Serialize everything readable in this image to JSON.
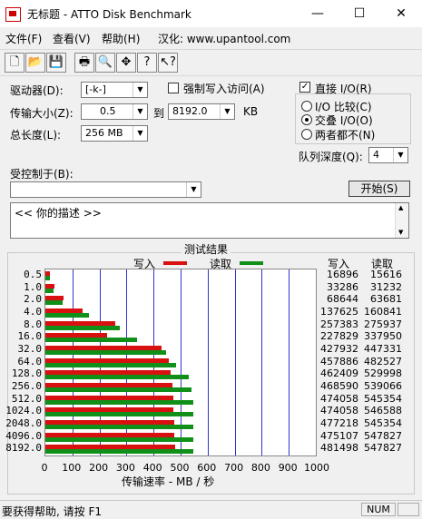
{
  "window": {
    "title": "无标题 - ATTO Disk Benchmark",
    "minimize": "—",
    "maximize": "☐",
    "close": "✕"
  },
  "menu": {
    "file": "文件(F)",
    "view": "查看(V)",
    "help": "帮助(H)",
    "localized": "汉化: www.upantool.com"
  },
  "toolbar": [
    {
      "name": "new-icon",
      "glyph": "🗋"
    },
    {
      "name": "open-folder-icon",
      "glyph": "📂"
    },
    {
      "name": "save-icon",
      "glyph": "💾"
    },
    {
      "name": "print-icon",
      "glyph": "🖶"
    },
    {
      "name": "print-preview-icon",
      "glyph": "🔍"
    },
    {
      "name": "move-icon",
      "glyph": "✥"
    },
    {
      "name": "help-icon",
      "glyph": "?"
    },
    {
      "name": "context-help-icon",
      "glyph": "↖?"
    }
  ],
  "settings": {
    "drive_label": "驱动器(D):",
    "drive_value": "[-k-]",
    "force_write_label": "强制写入访问(A)",
    "transfer_label": "传输大小(Z):",
    "transfer_from": "0.5",
    "to_label": "到",
    "transfer_to": "8192.0",
    "unit": "KB",
    "length_label": "总长度(L):",
    "length_value": "256 MB",
    "direct_io_label": "直接 I/O(R)",
    "io_options": [
      "I/O 比较(C)",
      "交叠 I/O(O)",
      "两者都不(N)"
    ],
    "queue_label": "队列深度(Q):",
    "queue_value": "4",
    "controlled_label": "受控制于(B):",
    "controlled_value": "",
    "start_button": "开始(S)",
    "description": "<<  你的描述   >>"
  },
  "results": {
    "title": "测试结果",
    "write_legend": "写入",
    "read_legend": "读取",
    "write_header": "写入",
    "read_header": "读取",
    "xlabel": "传输速率 - MB / 秒"
  },
  "status": {
    "hint": "要获得帮助, 请按 F1",
    "num": "NUM"
  },
  "colors": {
    "write": "#d81010",
    "read": "#109018",
    "gridline": "#3333cc"
  },
  "chart_data": {
    "type": "bar",
    "orientation": "horizontal",
    "categories": [
      "0.5",
      "1.0",
      "2.0",
      "4.0",
      "8.0",
      "16.0",
      "32.0",
      "64.0",
      "128.0",
      "256.0",
      "512.0",
      "1024.0",
      "2048.0",
      "4096.0",
      "8192.0"
    ],
    "series": [
      {
        "name": "写入",
        "values": [
          16896,
          33286,
          68644,
          137625,
          257383,
          227829,
          427932,
          457886,
          462409,
          468590,
          474058,
          474058,
          477218,
          475107,
          481498
        ]
      },
      {
        "name": "读取",
        "values": [
          15616,
          31232,
          63681,
          160841,
          275937,
          337950,
          447331,
          482527,
          529998,
          539066,
          545354,
          546588,
          545354,
          547827,
          547827
        ]
      }
    ],
    "xticks": [
      "0",
      "100",
      "200",
      "300",
      "400",
      "500",
      "600",
      "700",
      "800",
      "900",
      "1000"
    ],
    "xlim": [
      0,
      1000
    ],
    "xlabel": "传输速率 - MB / 秒",
    "legend": "top"
  }
}
